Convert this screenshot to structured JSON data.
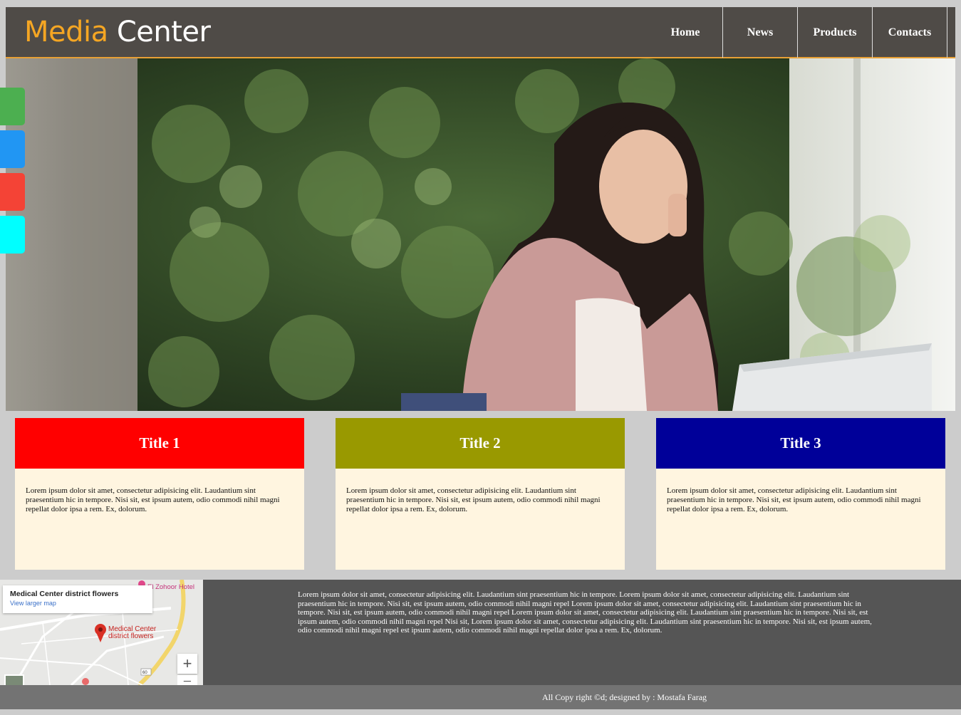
{
  "header": {
    "logo_part1": "Media",
    "logo_part2": "Center",
    "nav": [
      "Home",
      "News",
      "Products",
      "Contacts"
    ]
  },
  "hero": {
    "description": ""
  },
  "side_tabs": [
    {
      "color": "#4caf50"
    },
    {
      "color": "#2196f3"
    },
    {
      "color": "#f44336"
    },
    {
      "color": "#00ffff"
    }
  ],
  "cards": [
    {
      "title": "Title 1",
      "color": "#ff0000",
      "text": "Lorem ipsum dolor sit amet, consectetur adipisicing elit. Laudantium sint praesentium hic in tempore. Nisi sit, est ipsum autem, odio commodi nihil magni repellat dolor ipsa a rem. Ex, dolorum."
    },
    {
      "title": "Title 2",
      "color": "#999900",
      "text": "Lorem ipsum dolor sit amet, consectetur adipisicing elit. Laudantium sint praesentium hic in tempore. Nisi sit, est ipsum autem, odio commodi nihil magni repellat dolor ipsa a rem. Ex, dolorum."
    },
    {
      "title": "Title 3",
      "color": "#000099",
      "text": "Lorem ipsum dolor sit amet, consectetur adipisicing elit. Laudantium sint praesentium hic in tempore. Nisi sit, est ipsum autem, odio commodi nihil magni repellat dolor ipsa a rem. Ex, dolorum."
    }
  ],
  "map": {
    "title": "Medical Center district flowers",
    "link": "View larger map",
    "place": "Medical Center district flowers",
    "hotel": "El Zohoor Hotel",
    "zoom_in": "+",
    "zoom_out": "−"
  },
  "bottom_text": "Lorem ipsum dolor sit amet, consectetur adipisicing elit. Laudantium sint praesentium hic in tempore. Lorem ipsum dolor sit amet, consectetur adipisicing elit. Laudantium sint praesentium hic in tempore. Nisi sit, est ipsum autem, odio commodi nihil magni repel Lorem ipsum dolor sit amet, consectetur adipisicing elit. Laudantium sint praesentium hic in tempore. Nisi sit, est ipsum autem, odio commodi nihil magni repel Lorem ipsum dolor sit amet, consectetur adipisicing elit. Laudantium sint praesentium hic in tempore. Nisi sit, est ipsum autem, odio commodi nihil magni repel Nisi sit, Lorem ipsum dolor sit amet, consectetur adipisicing elit. Laudantium sint praesentium hic in tempore. Nisi sit, est ipsum autem, odio commodi nihil magni repel est ipsum autem, odio commodi nihil magni repellat dolor ipsa a rem. Ex, dolorum.",
  "footer": "All Copy right ©d; designed by : Mostafa Farag"
}
